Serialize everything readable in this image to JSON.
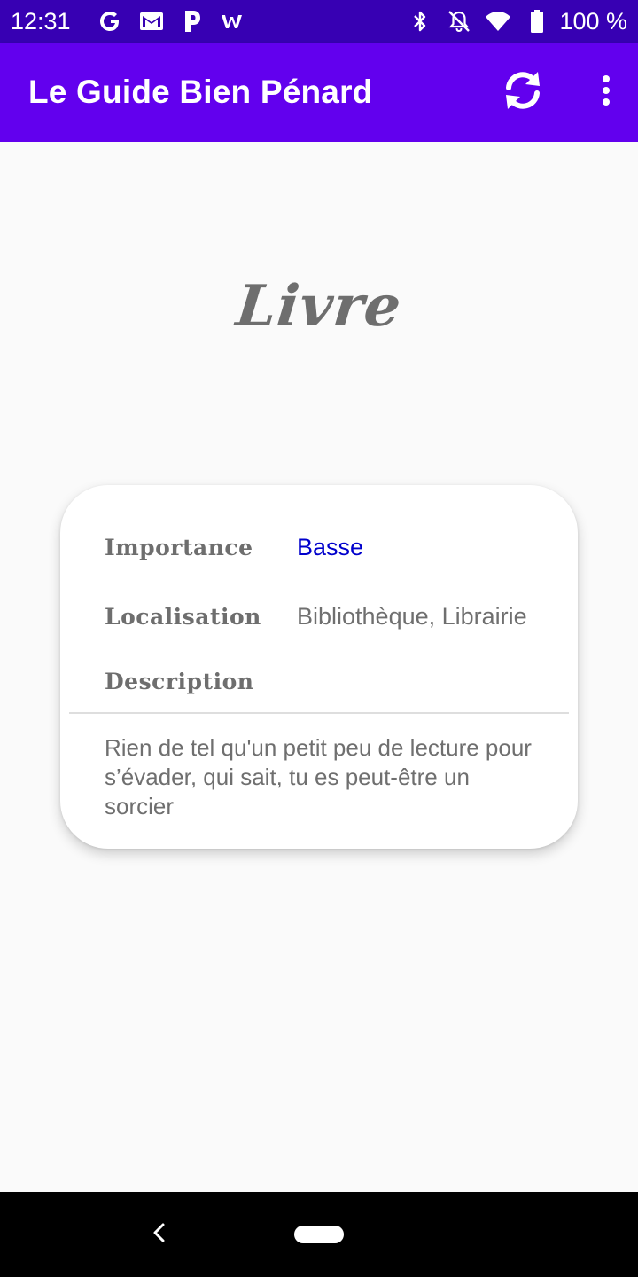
{
  "status_bar": {
    "time": "12:31",
    "notification_icons": [
      "google-g-icon",
      "gmail-icon",
      "p-app-icon",
      "w-app-icon"
    ],
    "right_icons": [
      "bluetooth-icon",
      "notifications-off-icon",
      "wifi-icon",
      "battery-icon"
    ],
    "battery": "100 %"
  },
  "app_bar": {
    "title": "Le Guide Bien Pénard",
    "actions": [
      "refresh-icon",
      "overflow-menu-icon"
    ]
  },
  "hero": {
    "title": "Livre"
  },
  "card": {
    "importance_label": "Importance",
    "importance_value": "Basse",
    "localisation_label": "Localisation",
    "localisation_value": "Bibliothèque, Librairie",
    "description_label": "Description",
    "description_text": "Rien de tel qu'un petit peu de lecture pour s’évader, qui sait, tu es peut-être un sorcier"
  },
  "colors": {
    "status_bar": "#3700b3",
    "app_bar": "#6200ee",
    "importance_value": "#0000cc",
    "label_gray": "#6e6e6e"
  },
  "nav_bar": {
    "buttons": [
      "back-icon",
      "home-pill"
    ]
  }
}
